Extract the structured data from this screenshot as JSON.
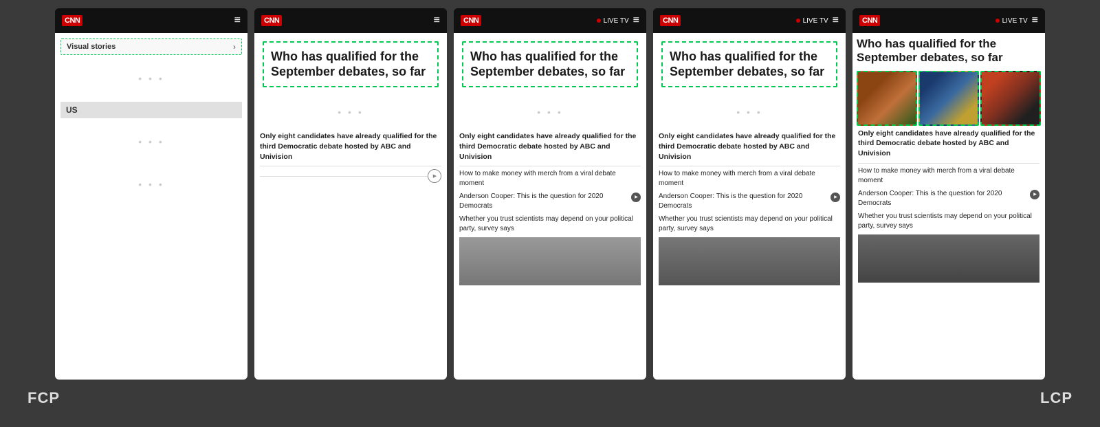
{
  "screenshots": [
    {
      "id": "frame1",
      "type": "fcp",
      "header": {
        "logo": "CNN",
        "menu": "≡",
        "live_tv": null
      },
      "visual_stories_label": "Visual stories",
      "us_label": "US",
      "headline": null,
      "show_dots": true
    },
    {
      "id": "frame2",
      "type": "middle",
      "header": {
        "logo": "CNN",
        "menu": "≡",
        "live_tv": null
      },
      "headline": "Who has qualified for the September debates, so far",
      "blurb": "Only eight candidates have already qualified for the third Democratic debate hosted by ABC and Univision",
      "show_dots": true
    },
    {
      "id": "frame3",
      "type": "middle",
      "header": {
        "logo": "CNN",
        "menu": "≡",
        "live_tv": "LIVE TV"
      },
      "headline": "Who has qualified for the September debates, so far",
      "blurb": "Only eight candidates have already qualified for the third Democratic debate hosted by ABC and Univision",
      "related": [
        "How to make money with merch from a viral debate moment",
        "Anderson Cooper: This is the question for 2020 Democrats",
        "Whether you trust scientists may depend on your political party, survey says"
      ],
      "show_dots": true,
      "show_bottom_image": true
    },
    {
      "id": "frame4",
      "type": "middle",
      "header": {
        "logo": "CNN",
        "menu": "≡",
        "live_tv": "LIVE TV"
      },
      "headline": "Who has qualified for the September debates, so far",
      "blurb": "Only eight candidates have already qualified for the third Democratic debate hosted by ABC and Univision",
      "related": [
        "How to make money with merch from a viral debate moment",
        "Anderson Cooper: This is the question for 2020 Democrats",
        "Whether you trust scientists may depend on your political party, survey says"
      ],
      "show_dots": true,
      "show_bottom_image": true
    },
    {
      "id": "frame5",
      "type": "lcp",
      "header": {
        "logo": "CNN",
        "menu": "≡",
        "live_tv": "LIVE TV"
      },
      "headline": "Who has qualified for the September debates, so far",
      "blurb": "Only eight candidates have already qualified for the third Democratic debate hosted by ABC and Univision",
      "related": [
        "How to make money with merch from a viral debate moment",
        "Anderson Cooper: This is the question for 2020 Democrats",
        "Whether you trust scientists may depend on your political party, survey says"
      ],
      "show_header_image": true,
      "show_bottom_image": true
    }
  ],
  "labels": {
    "fcp": "FCP",
    "lcp": "LCP"
  }
}
